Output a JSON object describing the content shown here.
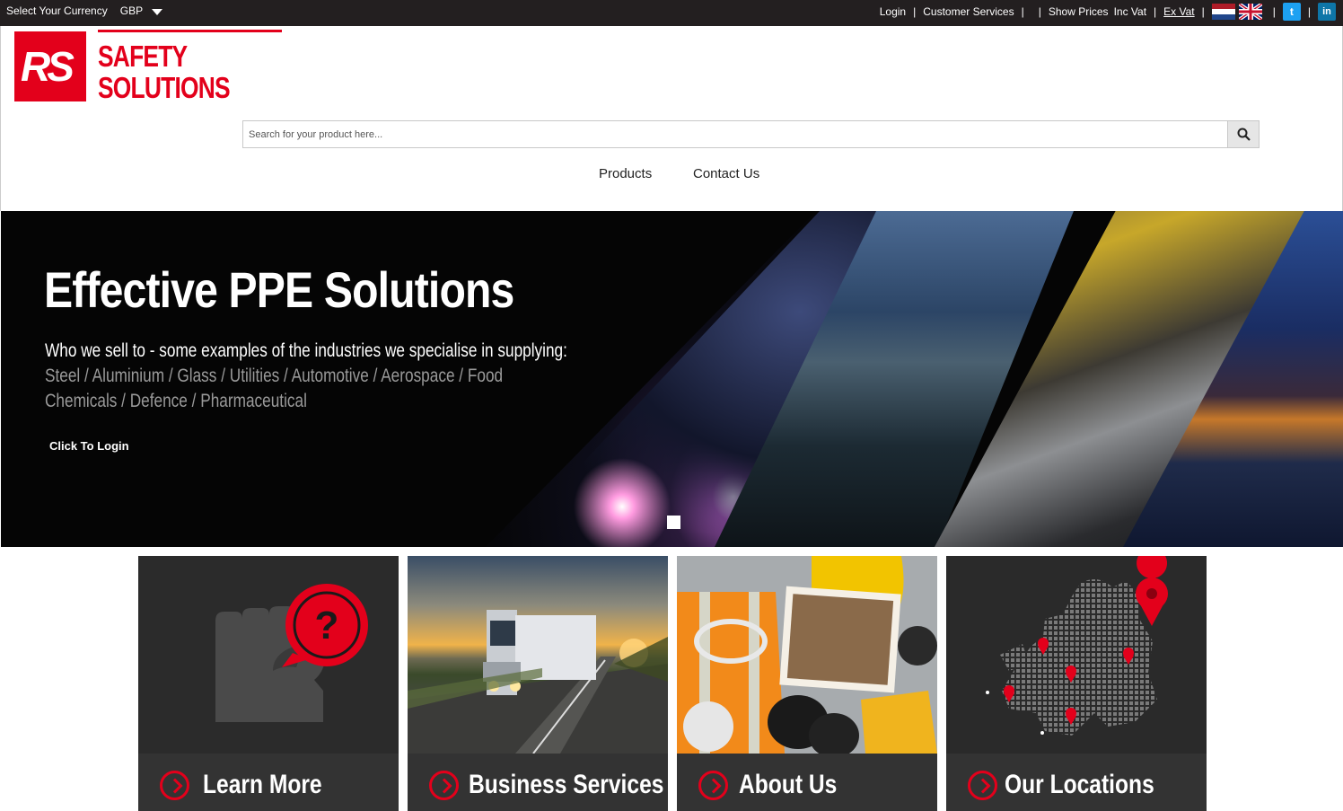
{
  "topbar": {
    "currency_label": "Select Your Currency",
    "currency_value": "GBP",
    "login": "Login",
    "customer_services": "Customer Services",
    "show_prices": "Show Prices",
    "inc_vat": "Inc Vat",
    "ex_vat": "Ex Vat",
    "twitter_letter": "t",
    "linkedin_letter": "in"
  },
  "logo": {
    "mark": "RS",
    "line1": "SAFETY",
    "line2": "SOLUTIONS"
  },
  "search": {
    "placeholder": "Search for your product here..."
  },
  "nav": {
    "products": "Products",
    "contact": "Contact Us"
  },
  "hero": {
    "title": "Effective PPE Solutions",
    "who": "Who we sell to  -  some examples of the industries we specialise in supplying:",
    "industries_line1": "Steel / Aluminium / Glass / Utilities / Automotive / Aerospace / Food",
    "industries_line2": "Chemicals / Defence / Pharmaceutical",
    "cta": "Click To Login"
  },
  "tiles": [
    {
      "label": "Learn More"
    },
    {
      "label": "Business Services"
    },
    {
      "label": "About Us"
    },
    {
      "label": "Our Locations"
    }
  ],
  "colors": {
    "brand_red": "#e3001b",
    "topbar_bg": "#231f20",
    "tile_bar": "#333333"
  }
}
